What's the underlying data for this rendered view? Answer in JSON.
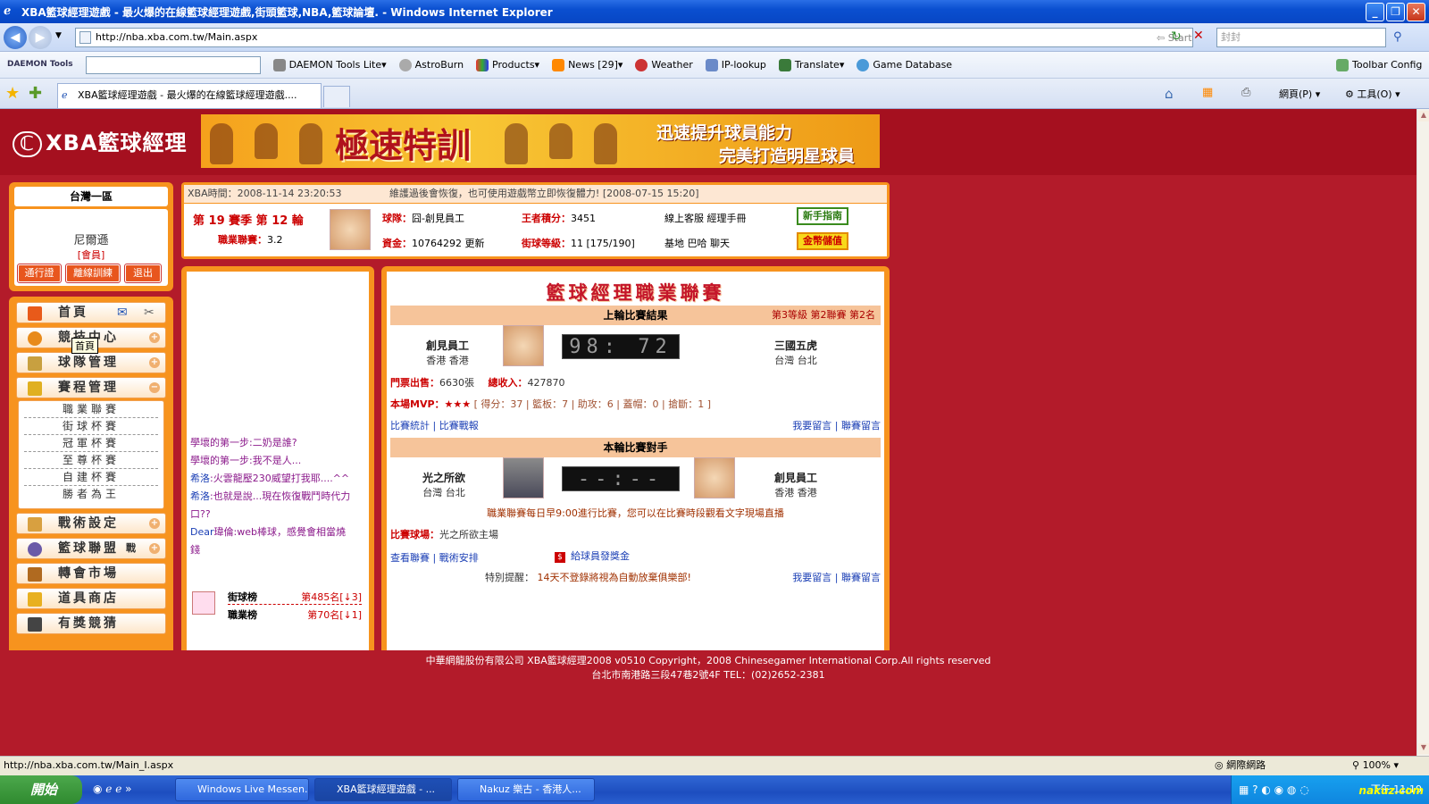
{
  "window": {
    "title": "XBA籃球經理遊戲 - 最火爆的在線籃球經理遊戲,街頭籃球,NBA,籃球論壇. - Windows Internet Explorer"
  },
  "address": {
    "url": "http://nba.xba.com.tw/Main.aspx",
    "start_search": "Start Search",
    "search_value": "封封"
  },
  "toolbar": {
    "daemon": "DAEMON Tools",
    "items": [
      "DAEMON Tools Lite",
      "AstroBurn",
      "Products",
      "News [29]",
      "Weather",
      "IP-lookup",
      "Translate",
      "Game Database"
    ],
    "config": "Toolbar Config"
  },
  "tabs": {
    "active": "XBA籃球經理遊戲 - 最火爆的在線籃球經理遊戲....",
    "home": "網頁(P)",
    "tools": "工具(O)"
  },
  "sidebar": {
    "server": "台灣一區",
    "username": "尼爾遜",
    "role": "[會員]",
    "buttons": [
      "通行證",
      "離線訓練",
      "退出"
    ],
    "nav": [
      "首頁",
      "競技中心",
      "球隊管理",
      "賽程管理",
      "戰術設定",
      "籃球聯盟",
      "轉會市場",
      "道具商店",
      "有獎競猜"
    ],
    "sub": [
      "職業聯賽",
      "街球杯賽",
      "冠軍杯賽",
      "至尊杯賽",
      "自建杯賽",
      "勝者為王"
    ],
    "tooltip": "首頁",
    "league_tag": "戰"
  },
  "info": {
    "time_label": "XBA時間：",
    "time": "2008-11-14 23:20:53",
    "notice": "維護過後會恢復，也可使用遊戲幣立即恢復體力! [2008-07-15 15:20]",
    "season": "第 19 賽季 第 12 輪",
    "pro_label": "職業聯賽：",
    "pro_value": "3.2",
    "team_label": "球隊：",
    "team": "囧-創見員工",
    "king_label": "王者積分：",
    "king": "3451",
    "links1": "線上客服  經理手冊",
    "funds_label": "資金：",
    "funds": "10764292 更新",
    "street_label": "街球等級：",
    "street": "11 [175/190]",
    "links2": "基地  巴哈  聊天",
    "guide": "新手指南",
    "gold": "金幣儲值"
  },
  "chat": {
    "messages": [
      {
        "name": "",
        "text": "學壞的第一步:二奶是誰?"
      },
      {
        "name": "",
        "text": "學壞的第一步:我不是人..."
      },
      {
        "name": "希洛",
        "text": ":火雲龍壓230威望打我耶....^^"
      },
      {
        "name": "希洛",
        "text": ":也就是說...現在恢復戰鬥時代力"
      },
      {
        "name": "",
        "text": "口??"
      },
      {
        "name": "Dear",
        "text": "瑋倫:web棒球，感覺會相當燒"
      },
      {
        "name": "",
        "text": "錢"
      }
    ],
    "rank": [
      {
        "label": "街球榜",
        "value": "第485名[↓3]"
      },
      {
        "label": "職業榜",
        "value": "第70名[↓1]"
      }
    ]
  },
  "league": {
    "title": "籃球經理職業聯賽",
    "last_result": "上輪比賽結果",
    "level": "第3等級  第2聯賽  第2名",
    "home_team": "創見員工",
    "home_loc": "香港  香港",
    "score": "98: 72",
    "away_team": "三國五虎",
    "away_loc": "台灣  台北",
    "tickets_label": "門票出售：",
    "tickets": "6630張",
    "income_label": "總收入：",
    "income": "427870",
    "mvp_label": "本場MVP：",
    "mvp_stars": "★★★",
    "mvp_stats": "[ 得分：37 | 籃板：7 | 助攻：6 | 蓋帽：0 | 搶斷：1 ]",
    "links_a": "比賽統計 | 比賽戰報",
    "links_b": "我要留言 | 聯賽留言",
    "this_round": "本輪比賽對手",
    "opp_team": "光之所欲",
    "opp_loc": "台灣  台北",
    "my_team": "創見員工",
    "my_loc": "香港  香港",
    "score2": "--:--",
    "schedule_note": "職業聯賽每日早9:00進行比賽，您可以在比賽時段觀看文字現場直播",
    "venue_label": "比賽球場：",
    "venue": "光之所欲主場",
    "links_c": "查看聯賽 | 戰術安排",
    "bonus": "給球員發獎金",
    "warn_label": "特別提醒：",
    "warn": "14天不登錄將視為自動放棄俱樂部!",
    "links_d": "我要留言 | 聯賽留言"
  },
  "footer": {
    "line1": "中華網龍股份有限公司  XBA籃球經理2008 v0510     Copyright，2008 Chinesegamer International Corp.All rights reserved",
    "line2": "台北市南港路三段47巷2號4F TEL：(02)2652-2381"
  },
  "status": {
    "url": "http://nba.xba.com.tw/Main_I.aspx",
    "zone": "網際網路",
    "zoom": "100%"
  },
  "taskbar": {
    "start": "開始",
    "tasks": [
      "Windows Live Messen...",
      "XBA籃球經理遊戲 - ...",
      "Nakuz 樂古 - 香港人..."
    ],
    "clock": "下午 11:19",
    "watermark": "nakuz.com"
  },
  "logo": {
    "text": "XBA籃球經理"
  },
  "banner": {
    "big": "極速特訓",
    "l1": "迅速提升球員能力",
    "l2": "完美打造明星球員"
  }
}
